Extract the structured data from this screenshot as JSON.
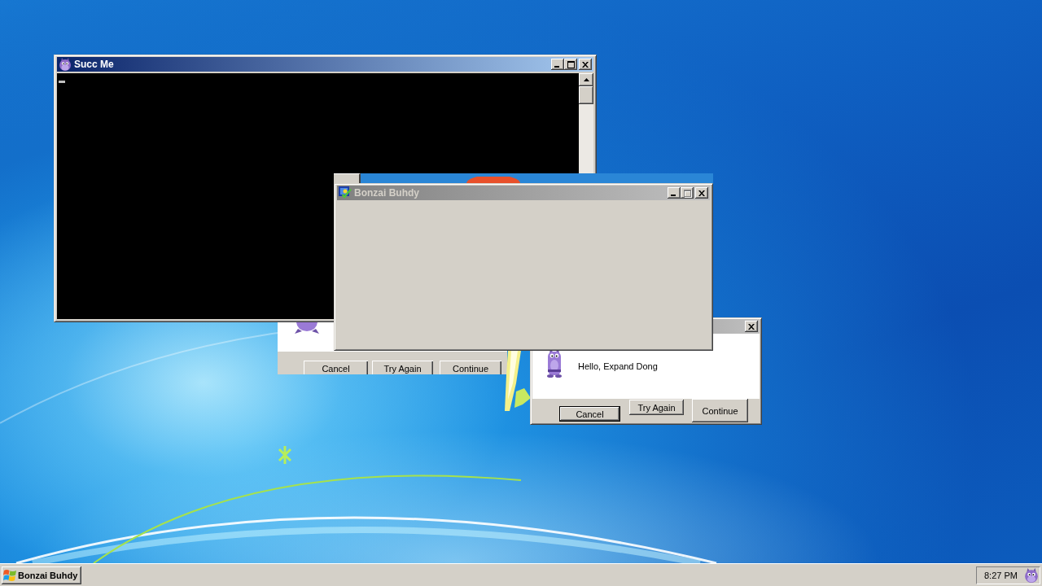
{
  "windows": [
    {
      "kind": "console",
      "title": "Succ Me",
      "active": true,
      "title_buttons": [
        {
          "kind": "minimize",
          "disabled": false
        },
        {
          "kind": "maximize",
          "disabled": false
        },
        {
          "kind": "close",
          "disabled": false
        }
      ]
    },
    {
      "kind": "blank",
      "title": "Bonzai Buhdy",
      "active": false,
      "title_buttons": [
        {
          "kind": "minimize",
          "disabled": false
        },
        {
          "kind": "maximize",
          "disabled": true
        },
        {
          "kind": "close",
          "disabled": false
        }
      ]
    },
    {
      "kind": "message",
      "buttons": [
        {
          "label": "Cancel",
          "default": false
        },
        {
          "label": "Try Again",
          "default": false
        },
        {
          "label": "Continue",
          "default": false
        }
      ]
    },
    {
      "kind": "message",
      "active": false,
      "title_buttons": [
        {
          "kind": "close",
          "disabled": false
        }
      ],
      "message": "Hello, Expand Dong",
      "buttons": [
        {
          "label": "Cancel",
          "default": true
        },
        {
          "label": "Try Again",
          "default": false
        },
        {
          "label": "Continue",
          "default": false
        }
      ]
    }
  ],
  "taskbar": {
    "tasks": [
      {
        "label": "Bonzai Buhdy",
        "selected": false
      }
    ],
    "clock": "8:27 PM"
  }
}
